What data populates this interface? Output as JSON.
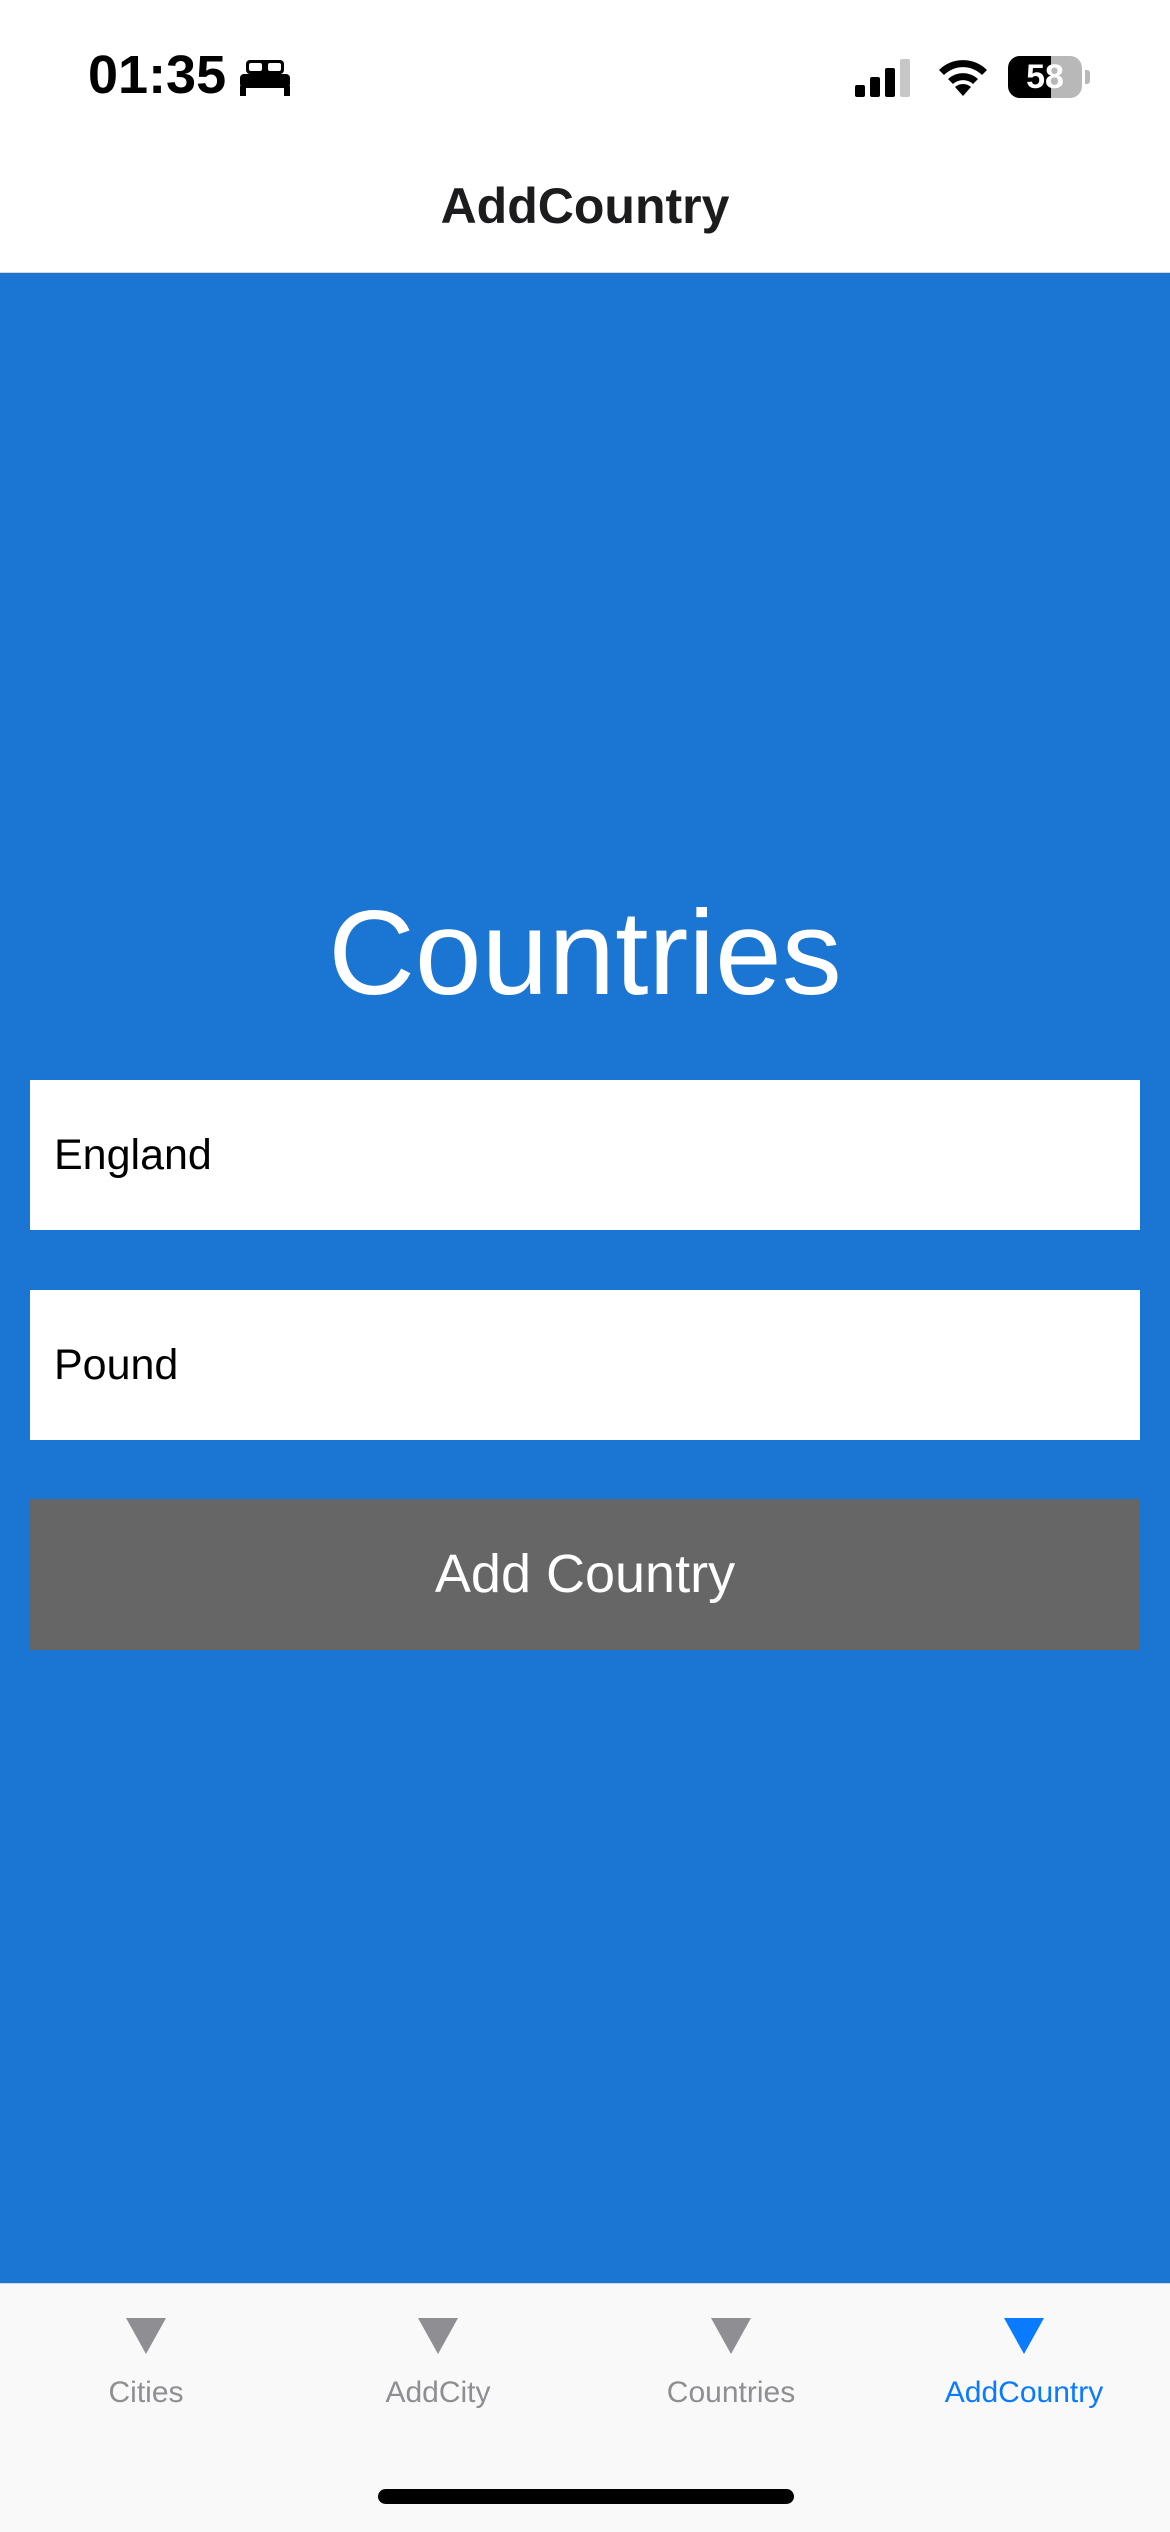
{
  "status_bar": {
    "time": "01:35",
    "battery_level": "58",
    "battery_fraction": 0.58,
    "icons": [
      "bed-icon",
      "cellular-signal-icon",
      "wifi-icon",
      "battery-icon"
    ]
  },
  "header": {
    "title": "AddCountry"
  },
  "main": {
    "background_color": "#1b76d3",
    "title": "Countries",
    "country_field": {
      "value": "England"
    },
    "currency_field": {
      "value": "Pound"
    },
    "add_button_label": "Add Country",
    "add_button_color": "#666666"
  },
  "tab_bar": {
    "active_color": "#0a7aff",
    "inactive_color": "#8e8e93",
    "tabs": [
      {
        "label": "Cities",
        "icon": "triangle-down-icon",
        "active": false
      },
      {
        "label": "AddCity",
        "icon": "triangle-down-icon",
        "active": false
      },
      {
        "label": "Countries",
        "icon": "triangle-down-icon",
        "active": false
      },
      {
        "label": "AddCountry",
        "icon": "triangle-down-icon",
        "active": true
      }
    ]
  }
}
